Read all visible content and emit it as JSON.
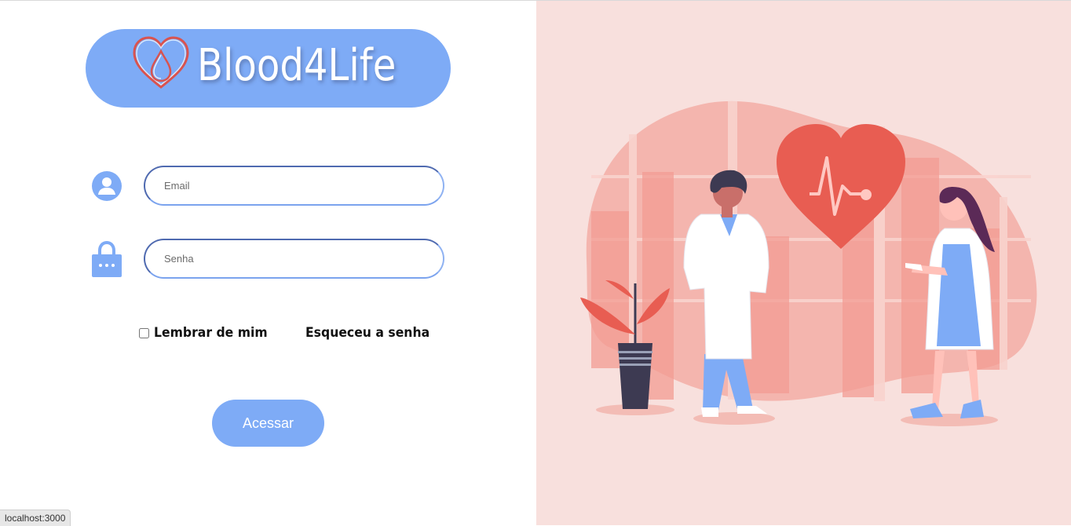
{
  "brand": {
    "name": "Blood4Life"
  },
  "login": {
    "email_placeholder": "Email",
    "password_placeholder": "Senha",
    "remember_label": "Lembrar de mim",
    "forgot_label": "Esqueceu a senha",
    "submit_label": "Acessar"
  },
  "status_bar": {
    "url": "localhost:3000"
  },
  "colors": {
    "accent": "#7eabf6",
    "right_panel_bg": "#f8e0dd",
    "heart": "#e85d52"
  },
  "icons": [
    "heart-drop-logo-icon",
    "user-icon",
    "lock-icon"
  ]
}
